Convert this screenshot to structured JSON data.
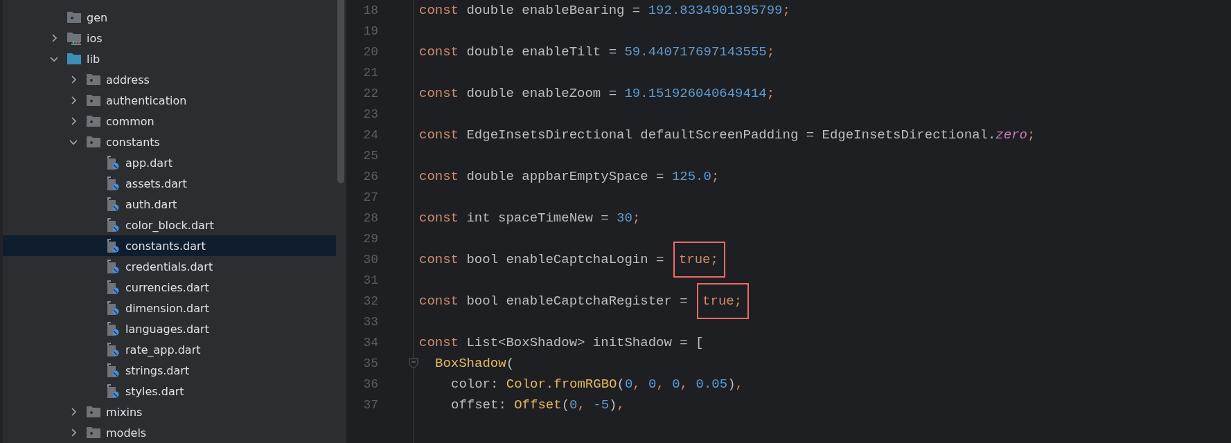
{
  "project_tree": {
    "items": [
      {
        "name": "gen",
        "kind": "generated_folder",
        "selected": false
      },
      {
        "name": "ios",
        "kind": "platform_folder",
        "expanded": false,
        "selected": false
      },
      {
        "name": "lib",
        "kind": "source_folder",
        "expanded": true,
        "selected": false,
        "children": [
          {
            "name": "address",
            "kind": "folder",
            "expanded": false,
            "selected": false
          },
          {
            "name": "authentication",
            "kind": "folder",
            "expanded": false,
            "selected": false
          },
          {
            "name": "common",
            "kind": "folder",
            "expanded": false,
            "selected": false
          },
          {
            "name": "constants",
            "kind": "folder",
            "expanded": true,
            "selected": false,
            "children": [
              {
                "name": "app.dart",
                "kind": "dart_file",
                "selected": false
              },
              {
                "name": "assets.dart",
                "kind": "dart_file",
                "selected": false
              },
              {
                "name": "auth.dart",
                "kind": "dart_file",
                "selected": false
              },
              {
                "name": "color_block.dart",
                "kind": "dart_file",
                "selected": false
              },
              {
                "name": "constants.dart",
                "kind": "dart_file",
                "selected": true
              },
              {
                "name": "credentials.dart",
                "kind": "dart_file",
                "selected": false
              },
              {
                "name": "currencies.dart",
                "kind": "dart_file",
                "selected": false
              },
              {
                "name": "dimension.dart",
                "kind": "dart_file",
                "selected": false
              },
              {
                "name": "languages.dart",
                "kind": "dart_file",
                "selected": false
              },
              {
                "name": "rate_app.dart",
                "kind": "dart_file",
                "selected": false
              },
              {
                "name": "strings.dart",
                "kind": "dart_file",
                "selected": false
              },
              {
                "name": "styles.dart",
                "kind": "dart_file",
                "selected": false
              }
            ]
          },
          {
            "name": "mixins",
            "kind": "folder",
            "expanded": false,
            "selected": false
          },
          {
            "name": "models",
            "kind": "folder",
            "expanded": false,
            "selected": false
          }
        ]
      }
    ]
  },
  "editor": {
    "lines": [
      {
        "number": "18",
        "tokens": [
          {
            "t": "const ",
            "kind": "keyword"
          },
          {
            "t": "double enableBearing = ",
            "kind": "plain"
          },
          {
            "t": "192.8334901395799",
            "kind": "number"
          },
          {
            "t": ";",
            "kind": "keyword"
          }
        ]
      },
      {
        "number": "19"
      },
      {
        "number": "20",
        "tokens": [
          {
            "t": "const ",
            "kind": "keyword"
          },
          {
            "t": "double enableTilt = ",
            "kind": "plain"
          },
          {
            "t": "59.440717697143555",
            "kind": "number"
          },
          {
            "t": ";",
            "kind": "keyword"
          }
        ]
      },
      {
        "number": "21"
      },
      {
        "number": "22",
        "tokens": [
          {
            "t": "const ",
            "kind": "keyword"
          },
          {
            "t": "double enableZoom = ",
            "kind": "plain"
          },
          {
            "t": "19.151926040649414",
            "kind": "number"
          },
          {
            "t": ";",
            "kind": "keyword"
          }
        ]
      },
      {
        "number": "23"
      },
      {
        "number": "24",
        "tokens": [
          {
            "t": "const ",
            "kind": "keyword"
          },
          {
            "t": "EdgeInsetsDirectional defaultScreenPadding = EdgeInsetsDirectional.",
            "kind": "plain"
          },
          {
            "t": "zero",
            "kind": "static_field"
          },
          {
            "t": ";",
            "kind": "keyword"
          }
        ]
      },
      {
        "number": "25"
      },
      {
        "number": "26",
        "tokens": [
          {
            "t": "const ",
            "kind": "keyword"
          },
          {
            "t": "double appbarEmptySpace = ",
            "kind": "plain"
          },
          {
            "t": "125.0",
            "kind": "number"
          },
          {
            "t": ";",
            "kind": "keyword"
          }
        ]
      },
      {
        "number": "27"
      },
      {
        "number": "28",
        "tokens": [
          {
            "t": "const ",
            "kind": "keyword"
          },
          {
            "t": "int spaceTimeNew = ",
            "kind": "plain"
          },
          {
            "t": "30",
            "kind": "number"
          },
          {
            "t": ";",
            "kind": "keyword"
          }
        ]
      },
      {
        "number": "29"
      },
      {
        "number": "30",
        "tokens": [
          {
            "t": "const ",
            "kind": "keyword"
          },
          {
            "t": "bool enableCaptchaLogin = ",
            "kind": "plain"
          }
        ],
        "boxed": {
          "t": "true;",
          "kind": "keyword"
        }
      },
      {
        "number": "31"
      },
      {
        "number": "32",
        "tokens": [
          {
            "t": "const ",
            "kind": "keyword"
          },
          {
            "t": "bool enableCaptchaRegister = ",
            "kind": "plain"
          }
        ],
        "boxed": {
          "t": "true;",
          "kind": "keyword"
        }
      },
      {
        "number": "33"
      },
      {
        "number": "34",
        "tokens": [
          {
            "t": "const ",
            "kind": "keyword"
          },
          {
            "t": "List<BoxShadow> initShadow = [",
            "kind": "plain"
          }
        ],
        "children": [
          {
            "number": "35",
            "fold": true,
            "tokens": [
              {
                "t": "BoxShadow",
                "kind": "function"
              },
              {
                "t": "(",
                "kind": "plain"
              }
            ],
            "children": [
              {
                "number": "36",
                "tokens": [
                  {
                    "t": "color: ",
                    "kind": "plain"
                  },
                  {
                    "t": "Color.fromRGBO",
                    "kind": "function"
                  },
                  {
                    "t": "(",
                    "kind": "plain"
                  },
                  {
                    "t": "0",
                    "kind": "number"
                  },
                  {
                    "t": ", ",
                    "kind": "keyword"
                  },
                  {
                    "t": "0",
                    "kind": "number"
                  },
                  {
                    "t": ", ",
                    "kind": "keyword"
                  },
                  {
                    "t": "0",
                    "kind": "number"
                  },
                  {
                    "t": ", ",
                    "kind": "keyword"
                  },
                  {
                    "t": "0.05",
                    "kind": "number"
                  },
                  {
                    "t": ")",
                    "kind": "plain"
                  },
                  {
                    "t": ",",
                    "kind": "keyword"
                  }
                ]
              },
              {
                "number": "37",
                "tokens": [
                  {
                    "t": "offset: ",
                    "kind": "plain"
                  },
                  {
                    "t": "Offset",
                    "kind": "function"
                  },
                  {
                    "t": "(",
                    "kind": "plain"
                  },
                  {
                    "t": "0",
                    "kind": "number"
                  },
                  {
                    "t": ", ",
                    "kind": "keyword"
                  },
                  {
                    "t": "-5",
                    "kind": "number"
                  },
                  {
                    "t": ")",
                    "kind": "plain"
                  },
                  {
                    "t": ",",
                    "kind": "keyword"
                  }
                ]
              }
            ]
          }
        ]
      }
    ]
  }
}
